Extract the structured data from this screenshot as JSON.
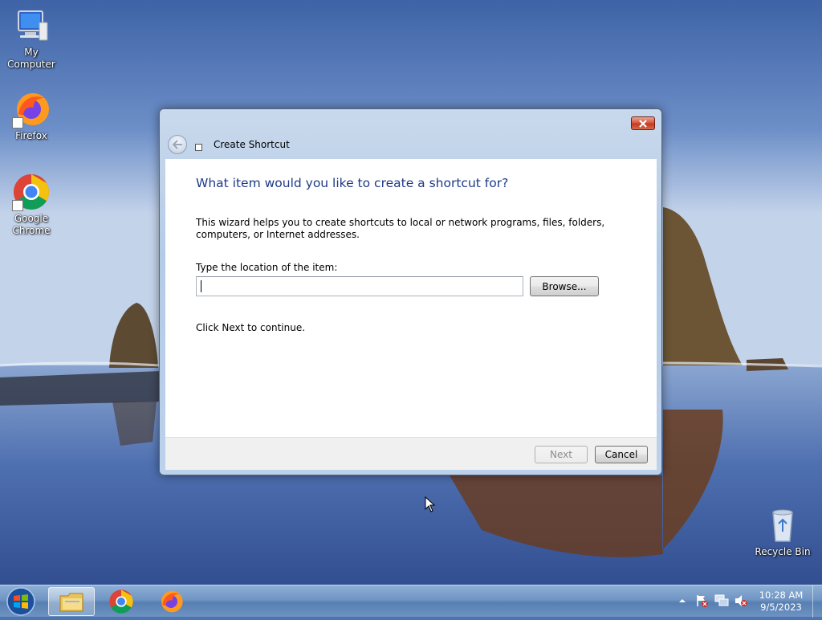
{
  "desktop": {
    "icons": [
      {
        "label": "My Computer",
        "icon": "computer-icon"
      },
      {
        "label": "Firefox",
        "icon": "firefox-icon"
      },
      {
        "label": "Google Chrome",
        "icon": "chrome-icon"
      },
      {
        "label": "Recycle Bin",
        "icon": "recycle-bin-icon"
      }
    ]
  },
  "dialog": {
    "title": "Create Shortcut",
    "heading": "What item would you like to create a shortcut for?",
    "description": "This wizard helps you to create shortcuts to local or network programs, files, folders, computers, or Internet addresses.",
    "location_label": "Type the location of the item:",
    "location_value": "",
    "browse_label": "Browse...",
    "hint": "Click Next to continue.",
    "next_label": "Next",
    "cancel_label": "Cancel",
    "next_enabled": false
  },
  "taskbar": {
    "pinned": [
      {
        "name": "Windows Explorer",
        "icon": "folder-icon",
        "active": true
      },
      {
        "name": "Google Chrome",
        "icon": "chrome-icon"
      },
      {
        "name": "Firefox",
        "icon": "firefox-icon"
      }
    ],
    "tray_icons": [
      "show-hidden-icons-icon",
      "action-center-flag-icon",
      "network-icon",
      "volume-muted-icon"
    ],
    "time": "10:28 AM",
    "date": "9/5/2023"
  }
}
